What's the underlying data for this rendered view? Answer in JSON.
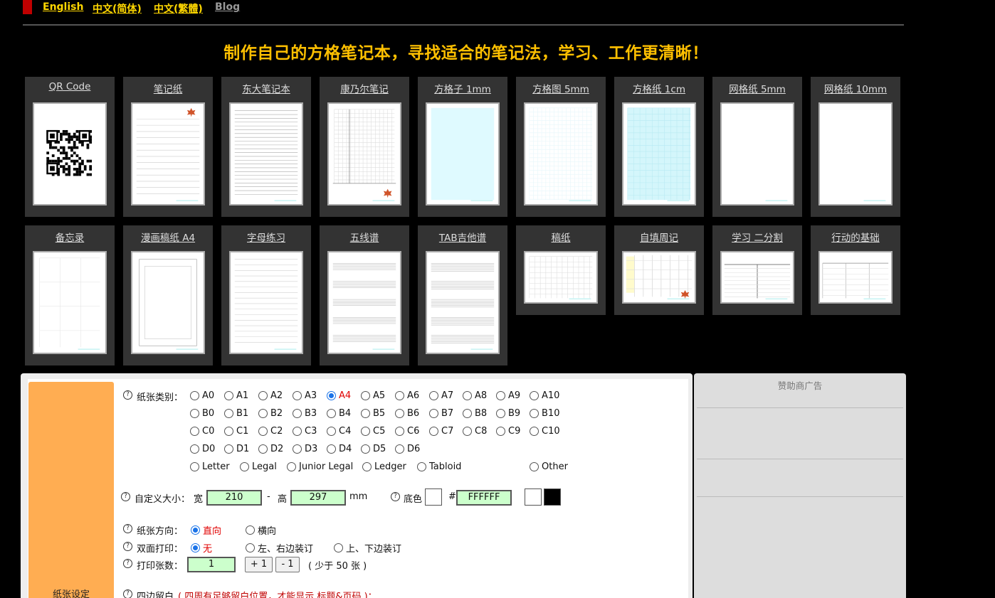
{
  "nav": {
    "links": [
      {
        "label": "English"
      },
      {
        "label": "中文(简体)"
      },
      {
        "label": "中文(繁體)"
      },
      {
        "label": "Blog"
      }
    ]
  },
  "headline": "制作自己的方格笔记本，寻找适合的笔记法，学习、工作更清晰！",
  "templates_row1": [
    {
      "label": "QR Code",
      "kind": "qr"
    },
    {
      "label": "笔记纸",
      "kind": "lined-leaf"
    },
    {
      "label": "东大笔记本",
      "kind": "dense-lined"
    },
    {
      "label": "康乃尔笔记",
      "kind": "cornell"
    },
    {
      "label": "方格子 1mm",
      "kind": "cyan-fill"
    },
    {
      "label": "方格图 5mm",
      "kind": "light-grid"
    },
    {
      "label": "方格纸 1cm",
      "kind": "cyan-grid"
    },
    {
      "label": "网格纸 5mm",
      "kind": "blank"
    },
    {
      "label": "网格纸 10mm",
      "kind": "blank"
    }
  ],
  "templates_row2": [
    {
      "label": "备忘录",
      "kind": "memo"
    },
    {
      "label": "漫画稿纸 A4",
      "kind": "manga"
    },
    {
      "label": "字母练习",
      "kind": "letters"
    },
    {
      "label": "五线谱",
      "kind": "staff"
    },
    {
      "label": "TAB吉他谱",
      "kind": "tab"
    },
    {
      "label": "稿纸",
      "kind": "genko"
    },
    {
      "label": "自填周记",
      "kind": "weekly"
    },
    {
      "label": "学习 二分割",
      "kind": "split"
    },
    {
      "label": "行动的基础",
      "kind": "action"
    }
  ],
  "settings": {
    "side_tab_label": "纸张设定",
    "paper_type_label": "纸张类别：",
    "help_icon": "?",
    "sizes": [
      [
        "A0",
        "A1",
        "A2",
        "A3",
        "A4",
        "A5",
        "A6",
        "A7",
        "A8",
        "A9",
        "A10"
      ],
      [
        "B0",
        "B1",
        "B2",
        "B3",
        "B4",
        "B5",
        "B6",
        "B7",
        "B8",
        "B9",
        "B10"
      ],
      [
        "C0",
        "C1",
        "C2",
        "C3",
        "C4",
        "C5",
        "C6",
        "C7",
        "C8",
        "C9",
        "C10"
      ],
      [
        "D0",
        "D1",
        "D2",
        "D3",
        "D4",
        "D5",
        "D6"
      ]
    ],
    "us_sizes": [
      "Letter",
      "Legal",
      "Junior Legal",
      "Ledger",
      "Tabloid"
    ],
    "other_label": "Other",
    "selected_size": "A4",
    "custom_size_label": "自定义大小：",
    "width_label": "宽",
    "width_value": "210",
    "dash": "-",
    "height_label": "高",
    "height_value": "297",
    "unit": "mm",
    "bg_color_label": "底色",
    "hash": "#",
    "bg_color_value": "FFFFFF",
    "orientation_label": "纸张方向：",
    "orientation_options": [
      "直向",
      "横向"
    ],
    "duplex_label": "双面打印：",
    "duplex_options": [
      "无",
      "左、右边装订",
      "上、下边装订"
    ],
    "copies_label": "打印张数：",
    "copies_value": "1",
    "plus_label": "+ 1",
    "minus_label": "- 1",
    "copies_note": "( 少于 50 张 )",
    "margin_label": "四边留白",
    "margin_note": "( 四周有足够留白位置，才能显示 标题&页码 )："
  },
  "sponsor": {
    "title": "赞助商广告"
  },
  "colors": {
    "accent": "#ffc000",
    "nav_link": "#ffd700",
    "side_tab": "#ffad52",
    "input_bg": "#ccffcc",
    "selected_text": "#e00000"
  }
}
